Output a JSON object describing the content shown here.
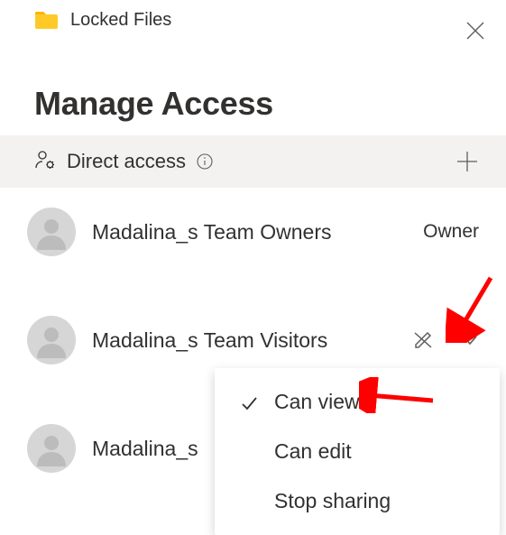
{
  "header": {
    "folder_name": "Locked Files"
  },
  "panel_title": "Manage Access",
  "section": {
    "label": "Direct access"
  },
  "entries": [
    {
      "name": "Madalina_s Team Owners",
      "role": "Owner",
      "dropdown": false
    },
    {
      "name": "Madalina_s Team Visitors",
      "role": null,
      "dropdown": true
    },
    {
      "name": "Madalina_s …",
      "role": null,
      "dropdown": false
    }
  ],
  "truncated_name_partial": "Madalina_s ",
  "dropdown": {
    "items": [
      {
        "label": "Can view",
        "selected": true
      },
      {
        "label": "Can edit",
        "selected": false
      },
      {
        "label": "Stop sharing",
        "selected": false
      }
    ]
  }
}
